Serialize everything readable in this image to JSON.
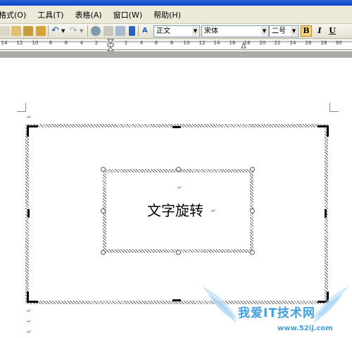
{
  "menu": {
    "items": [
      {
        "label": "格式(O)"
      },
      {
        "label": "工具(T)"
      },
      {
        "label": "表格(A)"
      },
      {
        "label": "窗口(W)"
      },
      {
        "label": "帮助(H)"
      }
    ]
  },
  "toolbar": {
    "style_value": "正文",
    "font_value": "宋体",
    "size_value": "二号",
    "bold_label": "B",
    "italic_label": "I",
    "underline_label": "U"
  },
  "ruler": {
    "labels": [
      "14",
      "12",
      "10",
      "8",
      "6",
      "4",
      "2",
      "2",
      "4",
      "6",
      "8",
      "10",
      "12",
      "14",
      "16",
      "18",
      "20",
      "22",
      "24",
      "26",
      "28",
      "30"
    ]
  },
  "document": {
    "para_mark": "↵",
    "textbox_text": "文字旋转"
  },
  "watermark": {
    "main": "我爱IT技术网",
    "url": "www.52ij.com"
  },
  "colors": {
    "title_bar": "#0c43c8",
    "menu_bg": "#ece9d8",
    "bold_highlight": "#ffd47a",
    "workspace": "#ababab",
    "watermark": "#3f9fe0"
  }
}
